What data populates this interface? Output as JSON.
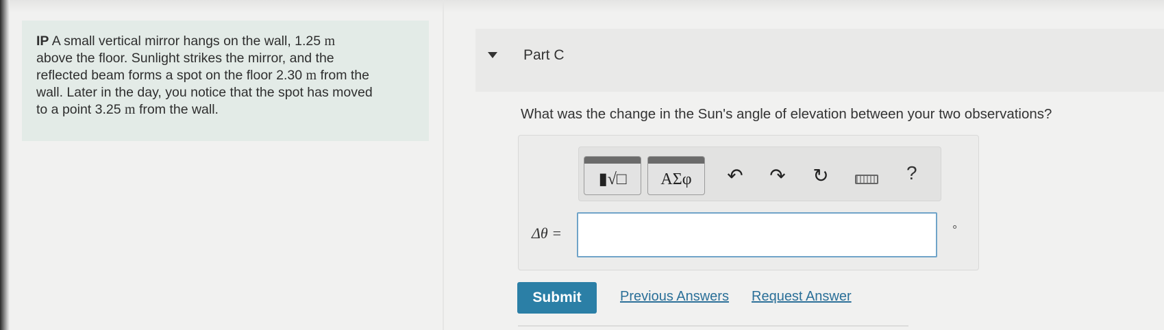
{
  "problem": {
    "prefix": "IP",
    "line1": " A small vertical mirror hangs on the wall, 1.25 ",
    "unit1": "m",
    "line2": "above the floor. Sunlight strikes the mirror, and the",
    "line3a": "reflected beam forms a spot on the floor 2.30 ",
    "unit2": "m",
    "line3b": " from the",
    "line4": "wall. Later in the day, you notice that the spot has moved",
    "line5a": "to a point 3.25 ",
    "unit3": "m",
    "line5b": " from the wall."
  },
  "part": {
    "title": "Part C",
    "question": "What was the change in the Sun's angle of elevation between your two observations?"
  },
  "toolbar": {
    "templates_label": "▮√□",
    "greek_label": "ΑΣφ",
    "undo_glyph": "↶",
    "redo_glyph": "↷",
    "reset_glyph": "↻",
    "help_glyph": "?"
  },
  "answer": {
    "label": "Δθ =",
    "value": "",
    "unit": "°"
  },
  "actions": {
    "submit": "Submit",
    "previous": "Previous Answers",
    "request": "Request Answer"
  }
}
